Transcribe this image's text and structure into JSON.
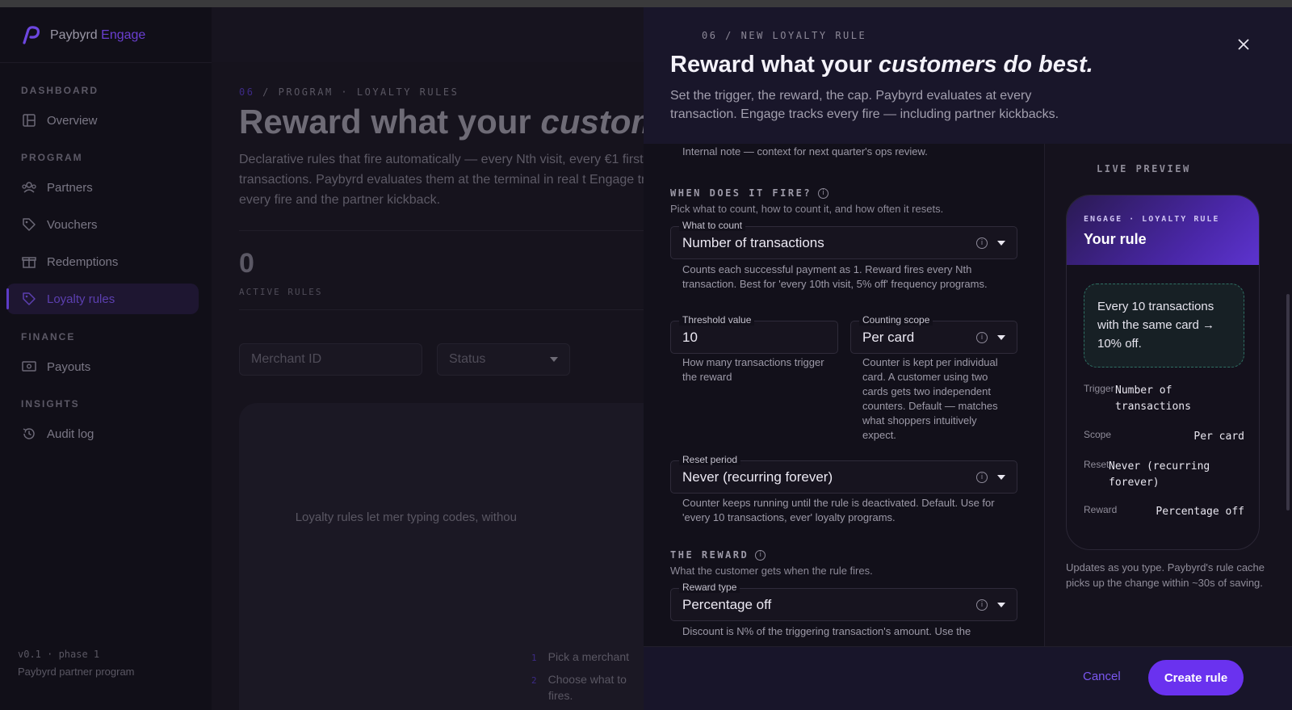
{
  "brand": {
    "name": "Paybyrd",
    "sub": "Engage"
  },
  "sidebar": {
    "sections": [
      {
        "label": "DASHBOARD",
        "items": [
          {
            "label": "Overview",
            "icon": "layout-icon"
          }
        ]
      },
      {
        "label": "PROGRAM",
        "items": [
          {
            "label": "Partners",
            "icon": "users-icon"
          },
          {
            "label": "Vouchers",
            "icon": "tag-icon"
          },
          {
            "label": "Redemptions",
            "icon": "gift-icon"
          },
          {
            "label": "Loyalty rules",
            "icon": "loyalty-tag-icon",
            "active": true
          }
        ]
      },
      {
        "label": "FINANCE",
        "items": [
          {
            "label": "Payouts",
            "icon": "cash-icon"
          }
        ]
      },
      {
        "label": "INSIGHTS",
        "items": [
          {
            "label": "Audit log",
            "icon": "history-icon"
          }
        ]
      }
    ],
    "version": "v0.1 · phase 1",
    "footer": "Paybyrd partner program"
  },
  "page": {
    "crumb_num": "06",
    "crumb_text": " / PROGRAM · LOYALTY RULES",
    "title_plain": "Reward what your ",
    "title_italic": "custom",
    "description": "Declarative rules that fire automatically — every Nth visit, every €1 first 3 transactions. Paybyrd evaluates them at the terminal in real t Engage tracks every fire and the partner kickback.",
    "stat_value": "0",
    "stat_label": "ACTIVE RULES",
    "merchant_placeholder": "Merchant ID",
    "status_label": "Status",
    "empty_text": "Loyalty rules let mer typing codes, withou",
    "steps": [
      {
        "n": "1",
        "text": "Pick a merchant"
      },
      {
        "n": "2",
        "text": "Choose what to"
      },
      {
        "n": "",
        "text": "fires."
      }
    ]
  },
  "drawer": {
    "eyebrow": "06 / NEW LOYALTY RULE",
    "title_plain": "Reward what your ",
    "title_italic": "customers do best.",
    "subtitle": "Set the trigger, the reward, the cap. Paybyrd evaluates at every transaction. Engage tracks every fire — including partner kickbacks.",
    "internal_note": "Internal note — context for next quarter's ops review.",
    "fire_section": {
      "title": "WHEN DOES IT FIRE?",
      "desc": "Pick what to count, how to count it, and how often it resets.",
      "what_to_count": {
        "label": "What to count",
        "value": "Number of transactions",
        "help": "Counts each successful payment as 1. Reward fires every Nth transaction. Best for 'every 10th visit, 5% off' frequency programs."
      },
      "threshold": {
        "label": "Threshold value",
        "value": "10",
        "help": "How many transactions trigger the reward"
      },
      "scope": {
        "label": "Counting scope",
        "value": "Per card",
        "help": "Counter is kept per individual card. A customer using two cards gets two independent counters. Default — matches what shoppers intuitively expect."
      },
      "reset": {
        "label": "Reset period",
        "value": "Never (recurring forever)",
        "help": "Counter keeps running until the rule is deactivated. Default. Use for 'every 10 transactions, ever' loyalty programs."
      }
    },
    "reward_section": {
      "title": "THE REWARD",
      "desc": "What the customer gets when the rule fires.",
      "reward_type": {
        "label": "Reward type",
        "value": "Percentage off",
        "help": "Discount is N% of the triggering transaction's amount. Use the"
      }
    },
    "preview": {
      "label": "LIVE PREVIEW",
      "eyebrow": "ENGAGE · LOYALTY RULE",
      "title": "Your rule",
      "summary": "Every 10 transactions with the same card → 10% off.",
      "rows": [
        {
          "k": "Trigger",
          "v": "Number of transactions"
        },
        {
          "k": "Scope",
          "v": "Per card"
        },
        {
          "k": "Reset",
          "v": "Never (recurring forever)"
        },
        {
          "k": "Reward",
          "v": "Percentage off"
        }
      ],
      "note": "Updates as you type. Paybyrd's rule cache picks up the change within ~30s of saving."
    },
    "cancel_label": "Cancel",
    "create_label": "Create rule"
  },
  "colors": {
    "accent": "#6a32ef",
    "accent_text": "#7b57f0",
    "drawer_bg": "#12101a"
  }
}
